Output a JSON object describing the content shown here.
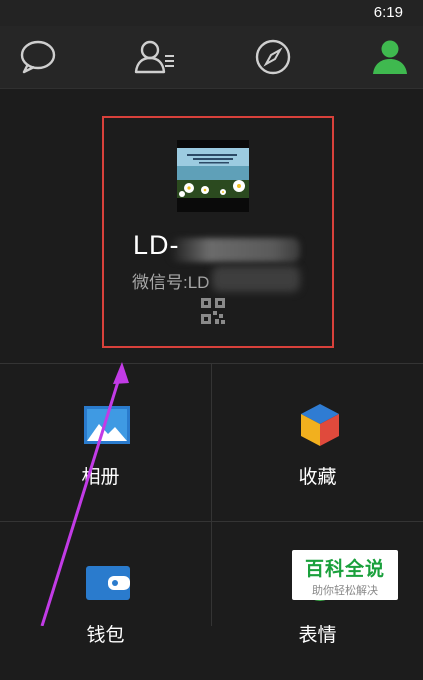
{
  "status": {
    "time": "6:19"
  },
  "tabs": [
    {
      "id": "chats",
      "icon": "chat-bubble-icon",
      "active": false
    },
    {
      "id": "contacts",
      "icon": "contacts-icon",
      "active": false
    },
    {
      "id": "discover",
      "icon": "compass-icon",
      "active": false
    },
    {
      "id": "me",
      "icon": "person-icon",
      "active": true
    }
  ],
  "profile": {
    "display_name": "LD-",
    "wechat_id": "微信号:LD",
    "avatar": "daisy-field-image",
    "qr": "qr-code-icon"
  },
  "menu": {
    "album_label": "相册",
    "favorites_label": "收藏",
    "wallet_label": "钱包",
    "emoji_label": "表情"
  },
  "watermark": {
    "title": "百科全说",
    "subtitle": "助你轻松解决"
  },
  "colors": {
    "background": "#1c1c1c",
    "tabbar": "#262626",
    "accent_green": "#3fb94f",
    "highlight_red": "#d9413b",
    "arrow_magenta": "#c23be6",
    "icon_blue": "#2a7bcd"
  }
}
